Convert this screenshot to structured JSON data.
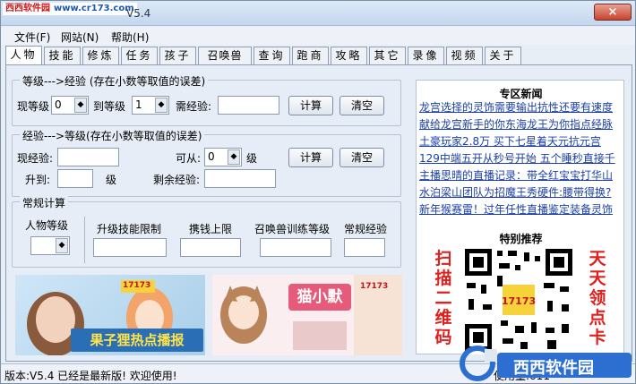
{
  "window": {
    "watermark_site": "西西软件园",
    "watermark_url": "www.cr173.com",
    "version_title": "V5.4",
    "close_symbol": "×"
  },
  "menu": [
    "文件(F)",
    "网站(N)",
    "帮助(H)"
  ],
  "tabs": [
    "人物",
    "技能",
    "修炼",
    "任务",
    "孩子",
    "召唤兽",
    "查询",
    "跑商",
    "攻略",
    "其它",
    "录像",
    "视频",
    "关于"
  ],
  "level_to_exp": {
    "title": "等级--->经验 (存在小数等取值的误差)",
    "current_level_label": "现等级",
    "current_level_value": "0",
    "to_level_label": "到等级",
    "to_level_value": "1",
    "need_exp_label": "需经验:",
    "need_exp_value": "",
    "calc_label": "计算",
    "clear_label": "清空"
  },
  "exp_to_level": {
    "title": "经验--->等级(存在小数等取值的误差)",
    "current_exp_label": "现经验:",
    "current_exp_value": "",
    "from_label": "可从:",
    "from_value": "0",
    "level_unit": "级",
    "upgrade_to_label": "升到:",
    "upgrade_to_value": "",
    "level_unit2": "级",
    "remaining_label": "剩余经验:",
    "remaining_value": "",
    "calc_label": "计算",
    "clear_label": "清空"
  },
  "general": {
    "title": "常规计算",
    "char_level_label": "人物等级",
    "char_level_value": "",
    "skill_limit_label": "升级技能限制",
    "money_limit_label": "携钱上限",
    "summon_level_label": "召唤兽训练等级",
    "regular_exp_label": "常规经验"
  },
  "banners": {
    "left_text": "果子狸热点播报",
    "right_text": "猫小默",
    "badge": "17173"
  },
  "news": {
    "title": "专区新闻",
    "items": [
      "龙宫选择的灵饰需要输出抗性还要有速度",
      "献给龙宫新手的你东海龙王为你指点经脉",
      "土豪玩家2.8万 买下七星着天元抗元宫",
      "129中端五开从秒号开始 五个睡秒直接千",
      "主播思晴的直播记录：带全红宝宝打华山",
      "水泊梁山团队为招魔王秀硬件:腰带得换?",
      "新年猴赛雷！过年任性直播鉴定装备灵饰"
    ],
    "qr_title": "特别推荐",
    "left_side": "扫描二维码",
    "right_side": "天天领点卡"
  },
  "status": {
    "text": "版本:V5.4 已经是最新版! 欢迎使用!",
    "used_label": "使用量:611"
  },
  "bottom_logo": "西西软件园",
  "colors": {
    "accent": "#1b3fa8",
    "close": "#c7432e",
    "promo_red": "#e0201c"
  }
}
